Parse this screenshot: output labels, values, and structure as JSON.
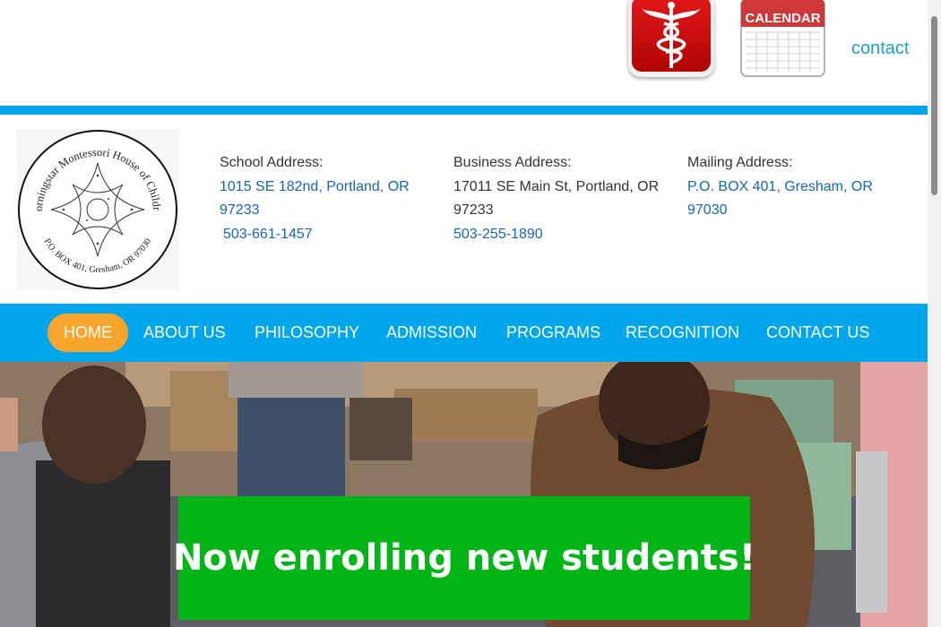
{
  "topbar": {
    "health_icon": "caduceus-icon",
    "calendar_label": "CALENDAR",
    "contact_label": "contact"
  },
  "logo": {
    "name": "Morningstar Montessori House of Children",
    "address": "P.O. BOX 401, Gresham, OR 97030"
  },
  "addresses": {
    "school": {
      "label": "School Address:",
      "line": "1015 SE 182nd, Portland, OR 97233",
      "phone": "503-661-1457"
    },
    "business": {
      "label": "Business Address:",
      "line": "17011 SE Main St, Portland, OR 97233",
      "phone": "503-255-1890"
    },
    "mailing": {
      "label": "Mailing Address:",
      "line": "P.O. BOX 401, Gresham, OR 97030"
    }
  },
  "nav": {
    "items": [
      {
        "label": "HOME",
        "active": true
      },
      {
        "label": "ABOUT US"
      },
      {
        "label": "PHILOSOPHY"
      },
      {
        "label": "ADMISSION"
      },
      {
        "label": "PROGRAMS"
      },
      {
        "label": "RECOGNITION"
      },
      {
        "label": "CONTACT US"
      }
    ]
  },
  "hero": {
    "banner": "Now enrolling new students!"
  },
  "colors": {
    "brand_blue": "#00a6ec",
    "active_orange": "#f7a52c",
    "banner_green": "#00b515",
    "link_blue": "#1565b5"
  }
}
